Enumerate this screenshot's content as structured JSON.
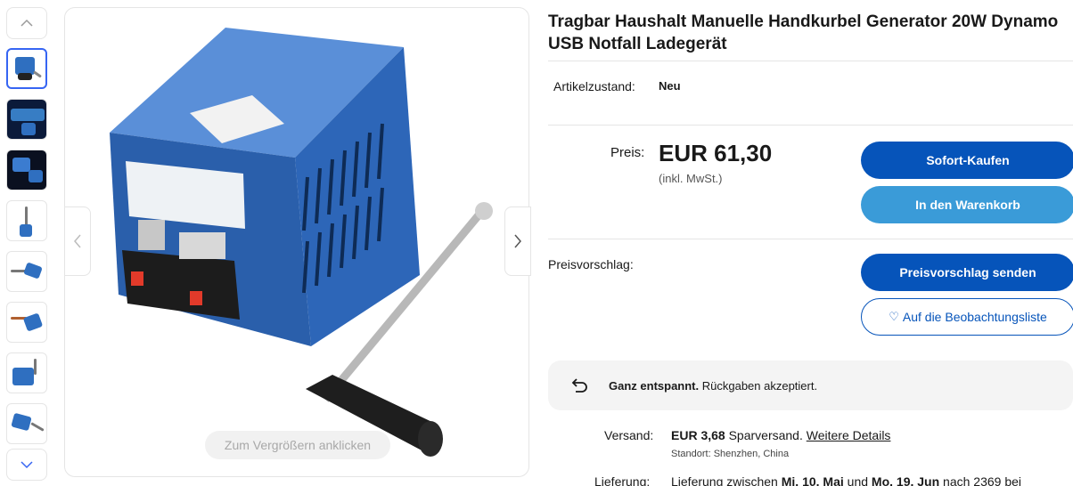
{
  "product": {
    "title": "Tragbar Haushalt Manuelle Handkurbel Generator 20W Dynamo USB Notfall Ladegerät"
  },
  "gallery": {
    "thumbnail_count": 8,
    "selected_index": 0,
    "zoom_hint": "Zum Vergrößern anklicken"
  },
  "condition": {
    "label": "Artikelzustand:",
    "value": "Neu"
  },
  "price": {
    "label": "Preis:",
    "value": "EUR 61,30",
    "note": "(inkl. MwSt.)"
  },
  "buttons": {
    "buy_now": "Sofort-Kaufen",
    "add_to_cart": "In den Warenkorb",
    "make_offer": "Preisvorschlag senden",
    "watchlist": "Auf die Beobachtungsliste"
  },
  "offer": {
    "label": "Preisvorschlag:"
  },
  "returns": {
    "bold": "Ganz entspannt.",
    "text": " Rückgaben akzeptiert."
  },
  "shipping": {
    "label": "Versand:",
    "price": "EUR 3,68",
    "method": " Sparversand. ",
    "details_link": "Weitere Details",
    "location": "Standort: Shenzhen, China"
  },
  "delivery": {
    "label": "Lieferung:",
    "text_prefix": "Lieferung zwischen ",
    "date_from": "Mi. 10. Mai",
    "text_mid": " und ",
    "date_to": "Mo. 19. Jun",
    "text_suffix": " nach 2369 bei"
  },
  "colors": {
    "primary_button": "#0654ba",
    "secondary_button": "#3a9bd8",
    "selected_thumb_border": "#3665f3",
    "product_blue": "#2f6fc0"
  }
}
